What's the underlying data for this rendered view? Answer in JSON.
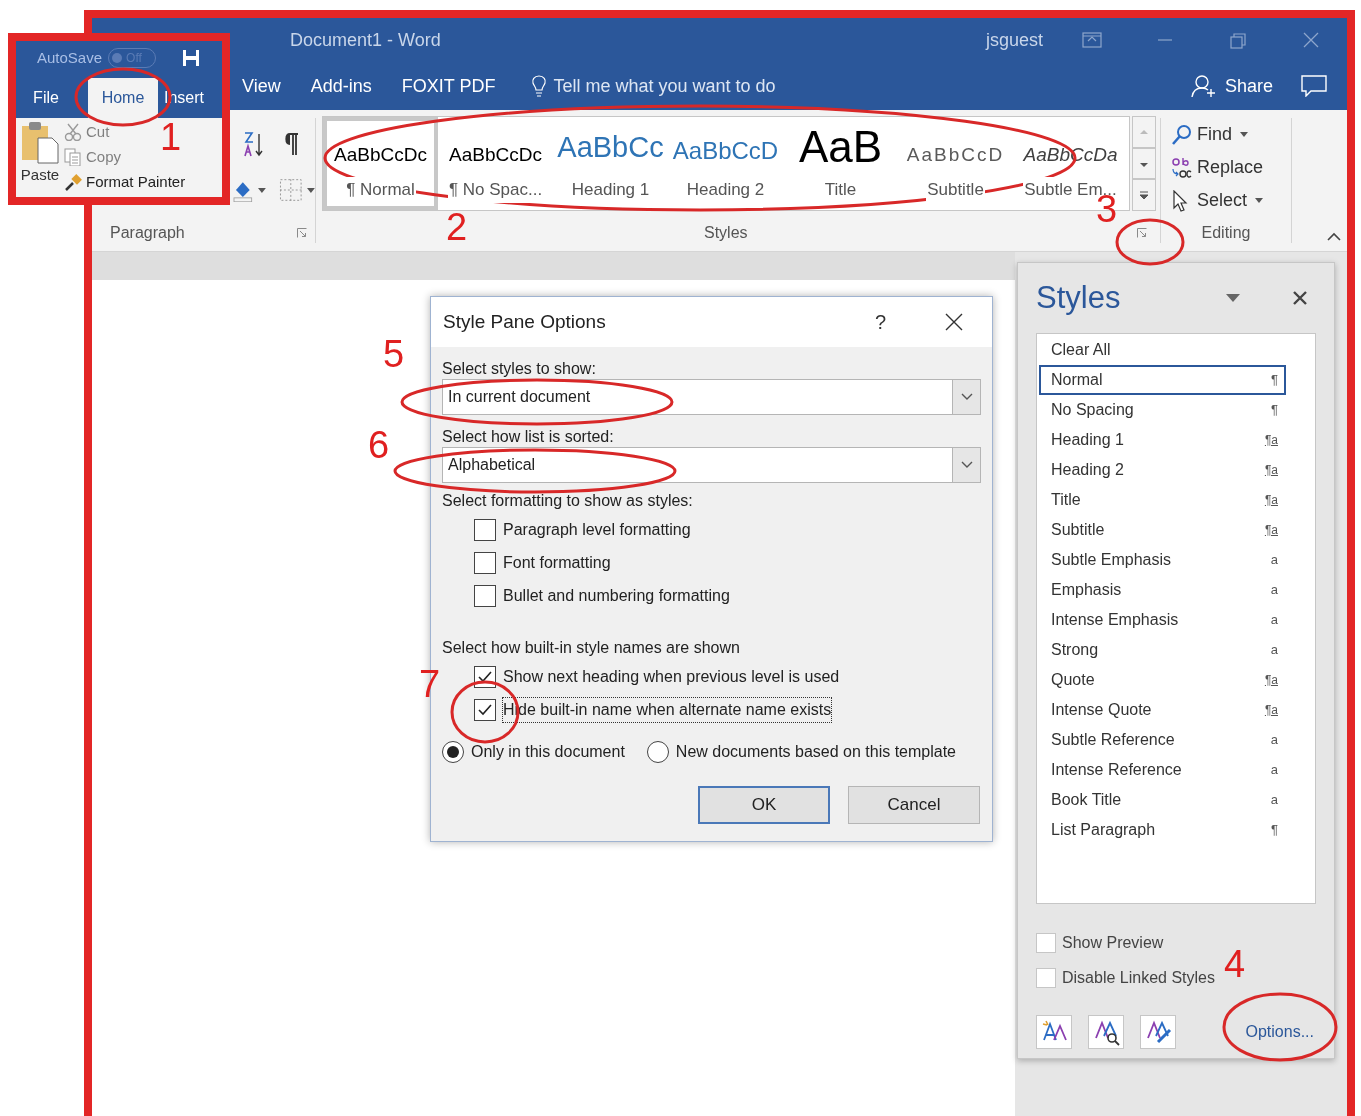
{
  "window": {
    "title": "Document1  -  Word",
    "user": "jsguest"
  },
  "quick_access": {
    "autosave": "AutoSave",
    "toggle": {
      "label": "Off",
      "on": false
    }
  },
  "inset_tabs": [
    {
      "label": "File",
      "selected": false
    },
    {
      "label": "Home",
      "selected": true
    },
    {
      "label": "Insert",
      "selected": false
    }
  ],
  "clipboard": {
    "paste": "Paste",
    "items": [
      {
        "label": "Cut",
        "kind": "cut",
        "disabled": true
      },
      {
        "label": "Copy",
        "kind": "copy",
        "disabled": true
      },
      {
        "label": "Format Painter",
        "kind": "painter",
        "disabled": false
      }
    ]
  },
  "tabs": [
    {
      "label": "View"
    },
    {
      "label": "Add-ins"
    },
    {
      "label": "FOXIT PDF"
    }
  ],
  "tell_me": {
    "placeholder": "Tell me what you want to do"
  },
  "share": "Share",
  "ribbon": {
    "paragraph_label": "Paragraph",
    "styles_label": "Styles",
    "editing_label": "Editing"
  },
  "style_gallery": [
    {
      "sample": "AaBbCcDc",
      "name": "¶ Normal",
      "kind": "normal",
      "selected": true
    },
    {
      "sample": "AaBbCcDc",
      "name": "¶ No Spac...",
      "kind": "normal",
      "selected": false
    },
    {
      "sample": "AaBbCc",
      "name": "Heading 1",
      "kind": "heading1",
      "selected": false
    },
    {
      "sample": "AaBbCcD",
      "name": "Heading 2",
      "kind": "heading2",
      "selected": false
    },
    {
      "sample": "AaB",
      "name": "Title",
      "kind": "title",
      "selected": false
    },
    {
      "sample": "AaBbCcD",
      "name": "Subtitle",
      "kind": "subtitle",
      "selected": false
    },
    {
      "sample": "AaBbCcDa",
      "name": "Subtle Em...",
      "kind": "emphasis",
      "selected": false
    }
  ],
  "editing": [
    {
      "label": "Find",
      "kind": "find",
      "dropdown": true
    },
    {
      "label": "Replace",
      "kind": "replace",
      "dropdown": false
    },
    {
      "label": "Select",
      "kind": "select",
      "dropdown": true
    }
  ],
  "styles_pane": {
    "title": "Styles",
    "items": [
      {
        "label": "Clear All",
        "selected": false
      },
      {
        "label": "Normal",
        "mark": "¶",
        "kind": "paragraph",
        "selected": true
      },
      {
        "label": "No Spacing",
        "mark": "¶",
        "kind": "paragraph",
        "selected": false
      },
      {
        "label": "Heading 1",
        "mark": "¶a",
        "kind": "linked",
        "selected": false
      },
      {
        "label": "Heading 2",
        "mark": "¶a",
        "kind": "linked",
        "selected": false
      },
      {
        "label": "Title",
        "mark": "¶a",
        "kind": "linked",
        "selected": false
      },
      {
        "label": "Subtitle",
        "mark": "¶a",
        "kind": "linked",
        "selected": false
      },
      {
        "label": "Subtle Emphasis",
        "mark": "a",
        "kind": "character",
        "selected": false
      },
      {
        "label": "Emphasis",
        "mark": "a",
        "kind": "character",
        "selected": false
      },
      {
        "label": "Intense Emphasis",
        "mark": "a",
        "kind": "character",
        "selected": false
      },
      {
        "label": "Strong",
        "mark": "a",
        "kind": "character",
        "selected": false
      },
      {
        "label": "Quote",
        "mark": "¶a",
        "kind": "linked",
        "selected": false
      },
      {
        "label": "Intense Quote",
        "mark": "¶a",
        "kind": "linked",
        "selected": false
      },
      {
        "label": "Subtle Reference",
        "mark": "a",
        "kind": "character",
        "selected": false
      },
      {
        "label": "Intense Reference",
        "mark": "a",
        "kind": "character",
        "selected": false
      },
      {
        "label": "Book Title",
        "mark": "a",
        "kind": "character",
        "selected": false
      },
      {
        "label": "List Paragraph",
        "mark": "¶",
        "kind": "paragraph",
        "selected": false
      }
    ],
    "checkboxes": [
      {
        "label": "Show Preview",
        "checked": false
      },
      {
        "label": "Disable Linked Styles",
        "checked": false
      }
    ],
    "options_link": "Options..."
  },
  "dialog": {
    "title": "Style Pane Options",
    "help": "?",
    "show_label": "Select styles to show:",
    "show_value": "In current document",
    "sort_label": "Select how list is sorted:",
    "sort_value": "Alphabetical",
    "format_label": "Select formatting to show as styles:",
    "format_options": [
      {
        "label": "Paragraph level formatting",
        "checked": false
      },
      {
        "label": "Font formatting",
        "checked": false
      },
      {
        "label": "Bullet and numbering formatting",
        "checked": false
      }
    ],
    "names_label": "Select how built-in style names are shown",
    "names_options": [
      {
        "label": "Show next heading when previous level is used",
        "checked": true,
        "focused": false
      },
      {
        "label": "Hide built-in name when alternate name exists",
        "checked": true,
        "focused": true
      }
    ],
    "scope": [
      {
        "label": "Only in this document",
        "selected": true
      },
      {
        "label": "New documents based on this template",
        "selected": false
      }
    ],
    "buttons": [
      {
        "label": "OK",
        "default": true
      },
      {
        "label": "Cancel",
        "default": false
      }
    ]
  },
  "annotations": [
    "1",
    "2",
    "3",
    "4",
    "5",
    "6",
    "7"
  ]
}
